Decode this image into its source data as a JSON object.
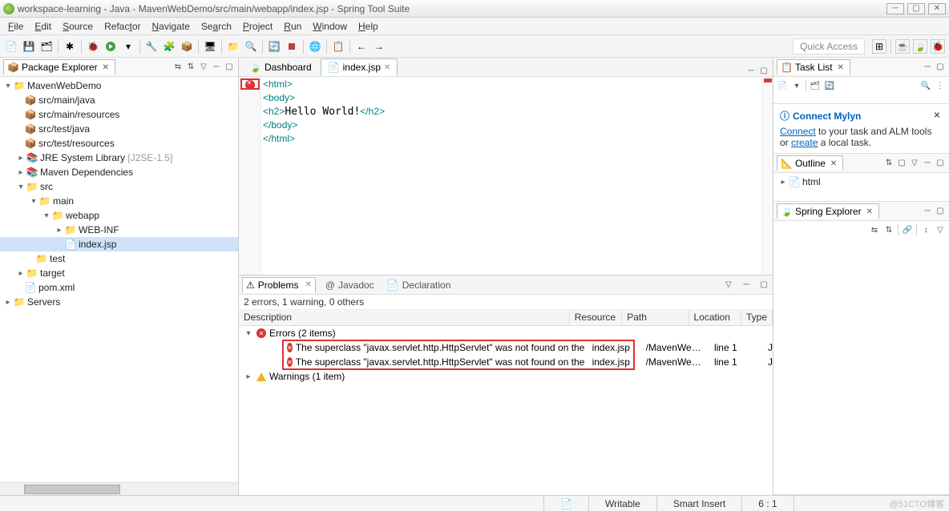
{
  "title": "workspace-learning - Java - MavenWebDemo/src/main/webapp/index.jsp - Spring Tool Suite",
  "menu": [
    "File",
    "Edit",
    "Source",
    "Refactor",
    "Navigate",
    "Search",
    "Project",
    "Run",
    "Window",
    "Help"
  ],
  "quick_access": "Quick Access",
  "package_explorer": {
    "title": "Package Explorer",
    "project": "MavenWebDemo",
    "nodes": {
      "src_main_java": "src/main/java",
      "src_main_resources": "src/main/resources",
      "src_test_java": "src/test/java",
      "src_test_resources": "src/test/resources",
      "jre": "JRE System Library",
      "jre_suffix": "[J2SE-1.5]",
      "maven_deps": "Maven Dependencies",
      "src": "src",
      "main": "main",
      "webapp": "webapp",
      "web_inf": "WEB-INF",
      "index_jsp": "index.jsp",
      "test": "test",
      "target": "target",
      "pom": "pom.xml",
      "servers": "Servers"
    }
  },
  "editor": {
    "tabs": {
      "dashboard": "Dashboard",
      "index": "index.jsp"
    },
    "code_lines": [
      "<html>",
      "<body>",
      "<h2>Hello World!</h2>",
      "</body>",
      "</html>"
    ]
  },
  "problems": {
    "tab_problems": "Problems",
    "tab_javadoc": "Javadoc",
    "tab_declaration": "Declaration",
    "summary": "2 errors, 1 warning, 0 others",
    "headers": {
      "desc": "Description",
      "res": "Resource",
      "path": "Path",
      "loc": "Location",
      "type": "Type"
    },
    "errors_group": "Errors (2 items)",
    "warnings_group": "Warnings (1 item)",
    "rows": [
      {
        "desc": "The superclass \"javax.servlet.http.HttpServlet\" was not found on the Java Build Path",
        "res": "index.jsp",
        "path": "/MavenWebDem...",
        "loc": "line 1",
        "type": "JSP Problem"
      },
      {
        "desc": "The superclass \"javax.servlet.http.HttpServlet\" was not found on the Java Build Path",
        "res": "index.jsp",
        "path": "/MavenWebDem...",
        "loc": "line 1",
        "type": "JSP Problem"
      }
    ]
  },
  "right": {
    "task_list": "Task List",
    "connect_mylyn_title": "Connect Mylyn",
    "connect_link": "Connect",
    "connect_text_1": " to your task and ALM tools or ",
    "create_link": "create",
    "connect_text_2": " a local task.",
    "outline": "Outline",
    "outline_item": "html",
    "spring_explorer": "Spring Explorer"
  },
  "status": {
    "writable": "Writable",
    "insert": "Smart Insert",
    "pos": "6 : 1"
  },
  "watermark": "@51CTO博客"
}
